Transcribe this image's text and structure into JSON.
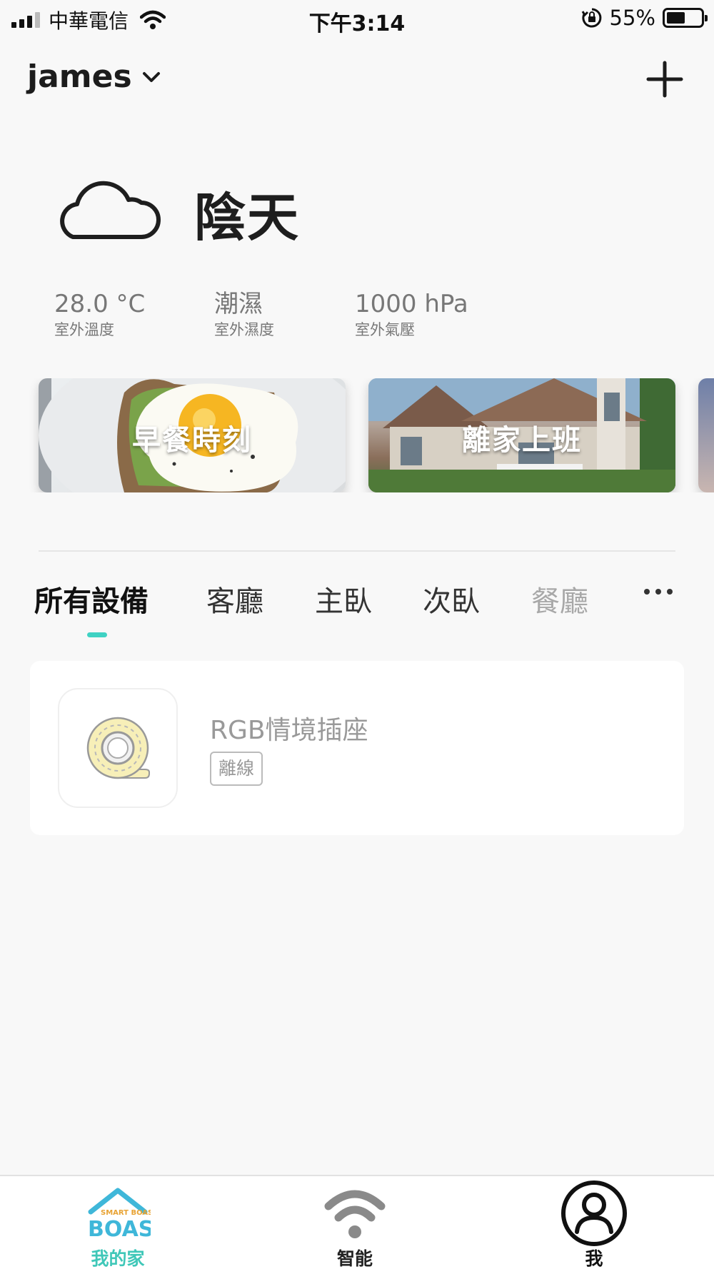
{
  "status_bar": {
    "carrier": "中華電信",
    "time": "下午3:14",
    "battery_percent": "55%",
    "battery_level": 0.55,
    "icons": [
      "signal-icon",
      "wifi-icon",
      "rotation-lock-icon",
      "battery-icon"
    ]
  },
  "header": {
    "home_name": "james",
    "dropdown_icon": "chevron-down-icon",
    "add_icon": "plus-icon"
  },
  "weather": {
    "icon": "cloud-icon",
    "condition": "陰天",
    "stats": [
      {
        "value": "28.0 °C",
        "label": "室外溫度"
      },
      {
        "value": "潮濕",
        "label": "室外濕度"
      },
      {
        "value": "1000 hPa",
        "label": "室外氣壓"
      }
    ]
  },
  "scenes": [
    {
      "label": "早餐時刻"
    },
    {
      "label": "離家上班"
    },
    {
      "label": ""
    }
  ],
  "tabs": [
    {
      "label": "所有設備",
      "active": true
    },
    {
      "label": "客廳"
    },
    {
      "label": "主臥"
    },
    {
      "label": "次臥"
    },
    {
      "label": "餐廳"
    }
  ],
  "more_icon": "more-horizontal-icon",
  "devices": [
    {
      "name": "RGB情境插座",
      "status": "離線",
      "icon": "socket-icon"
    }
  ],
  "bottom_nav": {
    "items": [
      {
        "label": "我的家",
        "icon": "smart-boas-logo",
        "active": true,
        "logo_text": "SMART BOAS"
      },
      {
        "label": "智能",
        "icon": "wifi-icon"
      },
      {
        "label": "我",
        "icon": "user-icon"
      }
    ]
  },
  "colors": {
    "accent": "#3fd2c3",
    "background": "#f8f8f8",
    "text_primary": "#1c1c1c",
    "text_secondary": "#777777"
  }
}
